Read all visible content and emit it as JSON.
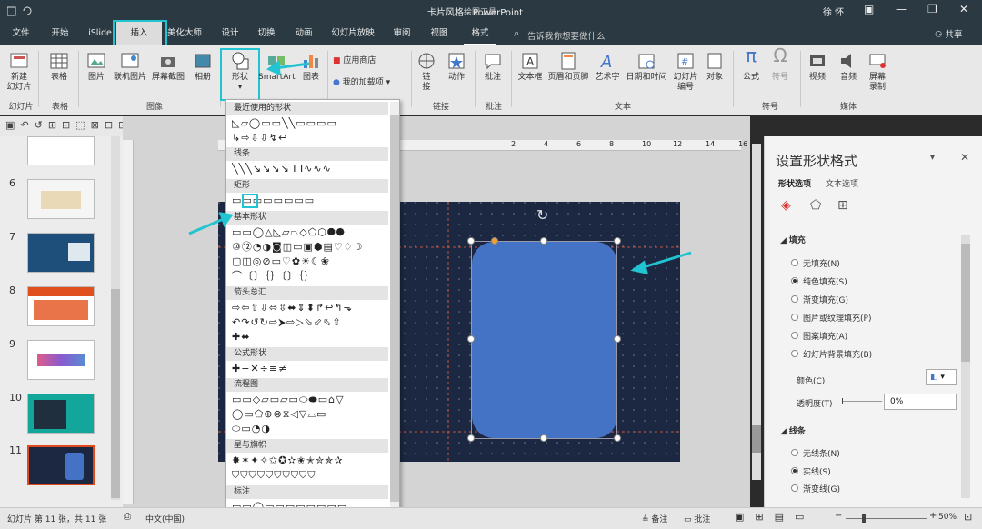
{
  "window": {
    "title": "卡片风格 - PowerPoint",
    "context_tab": "绘图工具",
    "user": "徐 怀"
  },
  "tabs": [
    {
      "label": "文件"
    },
    {
      "label": "开始"
    },
    {
      "label": "iSlide"
    },
    {
      "label": "插入"
    },
    {
      "label": "美化大师"
    },
    {
      "label": "设计"
    },
    {
      "label": "切换"
    },
    {
      "label": "动画"
    },
    {
      "label": "幻灯片放映"
    },
    {
      "label": "审阅"
    },
    {
      "label": "视图"
    },
    {
      "label": "格式"
    }
  ],
  "tell_me": "告诉我你想要做什么",
  "share": "共享",
  "ribbon": {
    "new_slide": "新建\n幻灯片",
    "table": "表格",
    "picture": "图片",
    "online_pic": "联机图片",
    "screenshot": "屏幕截图",
    "album": "相册",
    "shapes": "形状",
    "smartart": "SmartArt",
    "chart": "图表",
    "store": "应用商店",
    "my_addins": "我的加载项",
    "link": "链\n接",
    "action": "动作",
    "comment": "批注",
    "textbox": "文本框",
    "header_footer": "页眉和页脚",
    "wordart": "艺术字",
    "datetime": "日期和时间",
    "slide_no": "幻灯片\n编号",
    "object": "对象",
    "equation": "公式",
    "symbol": "符号",
    "video": "视频",
    "audio": "音频",
    "screen_rec": "屏幕\n录制",
    "groups": {
      "slides": "幻灯片",
      "tables": "表格",
      "images": "图像",
      "links": "链接",
      "comments": "批注",
      "text": "文本",
      "symbols": "符号",
      "media": "媒体"
    }
  },
  "shapes_menu": {
    "sections": [
      "最近使用的形状",
      "线条",
      "矩形",
      "基本形状",
      "箭头总汇",
      "公式形状",
      "流程图",
      "星与旗帜",
      "标注"
    ],
    "rows": [
      "◺▱◯▭▭╲╲▭▭▭▭",
      "↳⇨⇩⇩↯↩",
      "╲╲╲↘↘↘↘ᒣᒣ∿∿∿",
      "▭▭▭▭▭▭▭▭",
      "▭▭◯△◺▱⏢◇⬠⬡⯃⯄",
      "⑩⑫◔◑◙◫▭▣⬢▤♡♢☽",
      "▢◫◎⊘▭♡✿☀☾❀",
      "⌒〔〕｛｝〔〕｛｝",
      "⇨⇦⇧⇩⬄⇳⬌⇕⬍↱↩↰⬎",
      "↶↷↺↻⇨⮞⇨▷⬂⬃⬁⇧",
      "✚⬌",
      "✚−✕÷≡≠",
      "▭▭◇▱▭▱▭⬭⬬▭⌂▽",
      "◯▭⬠⊕⊗⧖◁▽⌓▭",
      "⬭▭◔◑",
      "✸✶✦✧✩✪✫✬✭✮✯✰",
      "⛉⛉⛉⛉⛉⛉⛉⛉⛉⛉",
      "▭▭◯▭▭▭▭▭▭▭▭"
    ]
  },
  "slides": [
    {
      "num": "6"
    },
    {
      "num": "7"
    },
    {
      "num": "8"
    },
    {
      "num": "9"
    },
    {
      "num": "10"
    },
    {
      "num": "11"
    }
  ],
  "ruler_marks": [
    "2",
    "4",
    "6",
    "8",
    "10",
    "12",
    "14",
    "16"
  ],
  "format_pane": {
    "title": "设置形状格式",
    "tab_shape": "形状选项",
    "tab_text": "文本选项",
    "fill_header": "填充",
    "fill_options": [
      "无填充(N)",
      "纯色填充(S)",
      "渐变填充(G)",
      "图片或纹理填充(P)",
      "图案填充(A)",
      "幻灯片背景填充(B)"
    ],
    "color_label": "颜色(C)",
    "transparency_label": "透明度(T)",
    "transparency_value": "0%",
    "line_header": "线条",
    "line_options": [
      "无线条(N)",
      "实线(S)",
      "渐变线(G)"
    ]
  },
  "status": {
    "slide_info": "幻灯片 第 11 张，共 11 张",
    "language": "中文(中国)",
    "notes": "备注",
    "comments": "批注",
    "zoom": "50%"
  },
  "colors": {
    "accent_cyan": "#21c4d0",
    "shape_fill": "#4472c4",
    "slide_bg": "#1c2742",
    "dark_chrome": "#2b3a42"
  }
}
